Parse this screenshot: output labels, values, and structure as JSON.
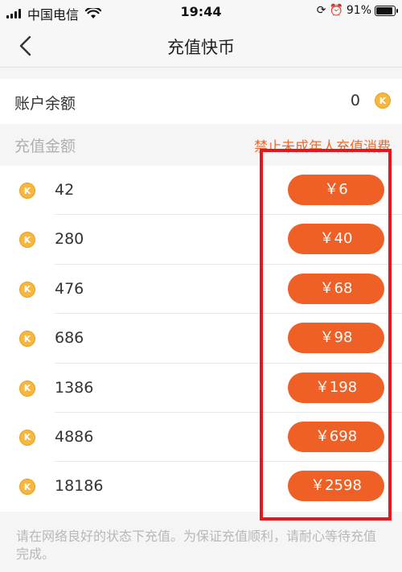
{
  "status_bar": {
    "carrier": "中国电信",
    "time": "19:44",
    "battery": "91%",
    "icons": [
      "signal-icon",
      "wifi-icon",
      "orientation-lock-icon",
      "alarm-icon",
      "battery-icon"
    ]
  },
  "nav": {
    "title": "充值快币",
    "back_icon": "chevron-left-icon"
  },
  "balance": {
    "label": "账户余额",
    "value": "0",
    "coin_symbol": "K"
  },
  "section": {
    "label": "充值金额",
    "warning": "禁止未成年人充值消费"
  },
  "packages": [
    {
      "coins": "42",
      "price": "￥6"
    },
    {
      "coins": "280",
      "price": "￥40"
    },
    {
      "coins": "476",
      "price": "￥68"
    },
    {
      "coins": "686",
      "price": "￥98"
    },
    {
      "coins": "1386",
      "price": "￥198"
    },
    {
      "coins": "4886",
      "price": "￥698"
    },
    {
      "coins": "18186",
      "price": "￥2598"
    }
  ],
  "footer": {
    "note": "请在网络良好的状态下充值。为保证充值顺利，请耐心等待充值完成。"
  },
  "colors": {
    "accent": "#ee6026",
    "warning": "#ef6a2f",
    "highlight_border": "#e8151c",
    "coin": "#f6b73c"
  }
}
